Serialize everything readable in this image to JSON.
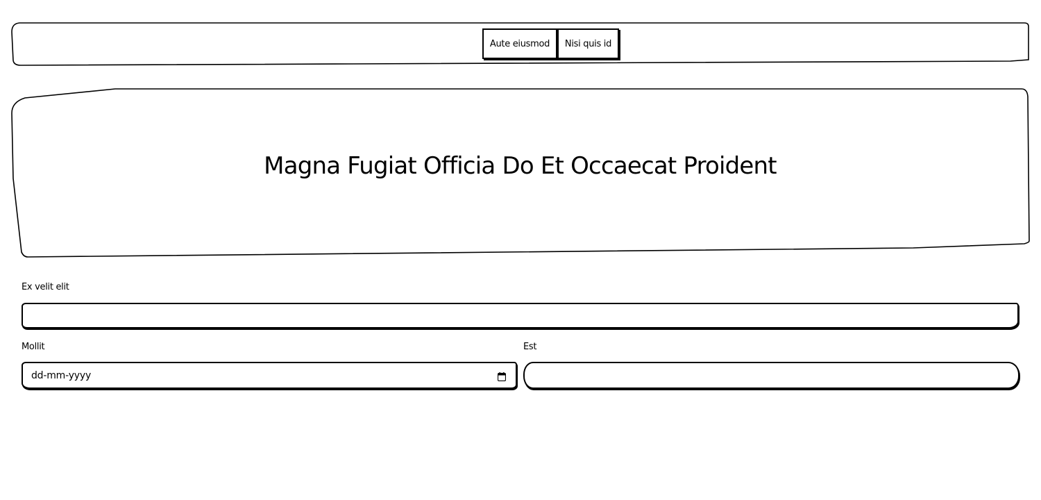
{
  "nav": {
    "buttons": [
      "Aute eiusmod",
      "Nisi quis id"
    ]
  },
  "hero": {
    "title": "Magna Fugiat Officia Do Et Occaecat Proident"
  },
  "form": {
    "field1": {
      "label": "Ex velit elit",
      "value": ""
    },
    "field2": {
      "label": "Mollit",
      "placeholder": "dd-mm-yyyy",
      "type": "date"
    },
    "field3": {
      "label": "Est",
      "value": ""
    }
  },
  "icons": {
    "date_picker": "calendar-icon"
  },
  "colors": {
    "ink": "#000000",
    "background": "#ffffff"
  }
}
